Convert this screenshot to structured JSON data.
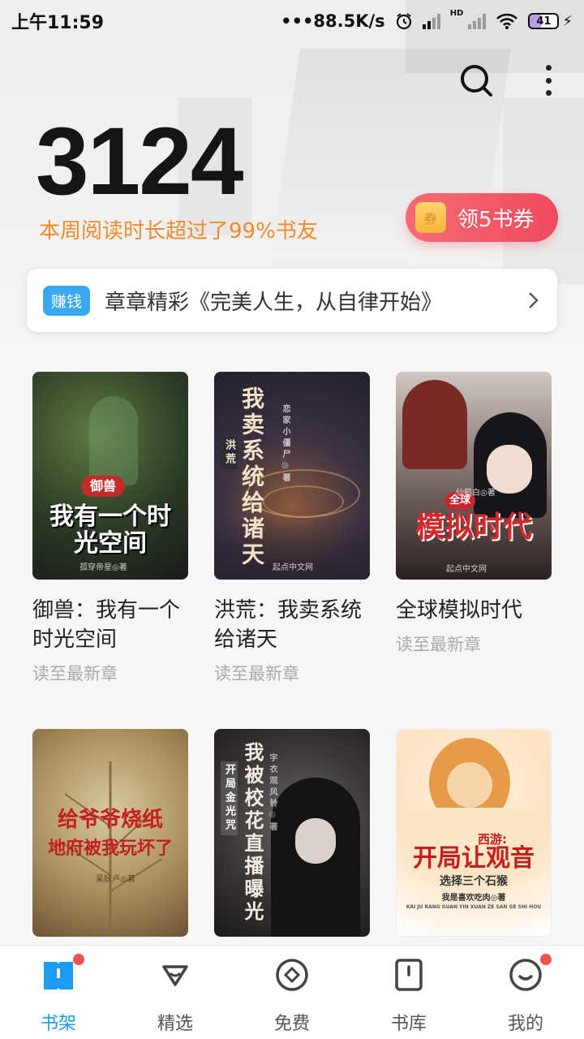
{
  "status_bar": {
    "time": "上午11:59",
    "speed": "•••88.5K/s",
    "hd": "HD",
    "battery": "41"
  },
  "stats": {
    "number": "3124",
    "subtitle": "本周阅读时长超过了99%书友"
  },
  "coupon": {
    "icon_text": "券",
    "label": "领5书券"
  },
  "banner": {
    "tag": "赚钱",
    "text": "章章精彩《完美人生，从自律开始》"
  },
  "books": [
    {
      "title": "御兽：我有一个时光空间",
      "progress": "读至最新章",
      "cover_title": "我有一个时光空间",
      "cover_tag": "御兽",
      "cover_author": "孤穿帝星◎著"
    },
    {
      "title": "洪荒：我卖系统给诸天",
      "progress": "读至最新章",
      "cover_title": "我卖系统给诸天",
      "cover_tag": "洪荒",
      "cover_author": "恋家小僵尸◎著",
      "cover_publisher": "起点中文网"
    },
    {
      "title": "全球模拟时代",
      "progress": "读至最新章",
      "cover_title": "模拟时代",
      "cover_tag": "全球",
      "cover_author": "仙鹤白◎著",
      "cover_publisher": "起点中文网"
    },
    {
      "title": "",
      "progress": "",
      "cover_title": "给爷爷烧纸",
      "cover_subtitle": "地府被我玩坏了",
      "cover_author": "呆妖卢◎著"
    },
    {
      "title": "",
      "progress": "",
      "cover_title": "我被校花直播曝光",
      "cover_tag": "开局金光咒",
      "cover_author": "字衣观风铃◎著"
    },
    {
      "title": "",
      "progress": "",
      "cover_title": "开局让观音",
      "cover_tag": "西游:",
      "cover_subtitle": "选择三个石猴",
      "cover_author": "我是喜欢吃肉◎著",
      "cover_pinyin": "KAI JU RANG GUAN YIN XUAN ZE SAN GE SHI HOU"
    }
  ],
  "tabbar": [
    {
      "label": "书架",
      "icon": "bookshelf-icon",
      "active": true,
      "dot": true
    },
    {
      "label": "精选",
      "icon": "featured-icon",
      "active": false,
      "dot": false
    },
    {
      "label": "免费",
      "icon": "free-icon",
      "active": false,
      "dot": false
    },
    {
      "label": "书库",
      "icon": "library-icon",
      "active": false,
      "dot": false
    },
    {
      "label": "我的",
      "icon": "profile-icon",
      "active": false,
      "dot": true
    }
  ],
  "colors": {
    "accent": "#1e9bf0",
    "orange": "#f08a2a",
    "coupon": "#f04b5d",
    "badge": "#f0534d"
  }
}
